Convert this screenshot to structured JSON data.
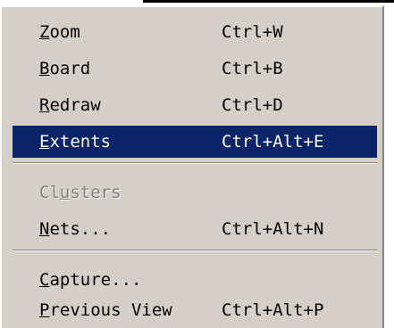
{
  "menu": {
    "items": [
      {
        "mnemonic": "Z",
        "rest": "oom",
        "shortcut": "Ctrl+W"
      },
      {
        "mnemonic": "B",
        "rest": "oard",
        "shortcut": "Ctrl+B"
      },
      {
        "mnemonic": "R",
        "rest": "edraw",
        "shortcut": "Ctrl+D"
      },
      {
        "mnemonic": "E",
        "rest": "xtents",
        "shortcut": "Ctrl+Alt+E",
        "selected": true
      },
      {
        "pre": "Cl",
        "mnemonic": "u",
        "rest": "sters",
        "shortcut": "",
        "disabled": true
      },
      {
        "mnemonic": "N",
        "rest": "ets...",
        "shortcut": "Ctrl+Alt+N"
      },
      {
        "mnemonic": "C",
        "rest": "apture...",
        "shortcut": ""
      },
      {
        "mnemonic": "P",
        "rest": "revious View",
        "shortcut": "Ctrl+Alt+P"
      }
    ]
  },
  "colors": {
    "menu_background": "#d4d0c8",
    "selection_background": "#0a246a",
    "selection_text": "#ffffff",
    "disabled_text": "#808080"
  }
}
